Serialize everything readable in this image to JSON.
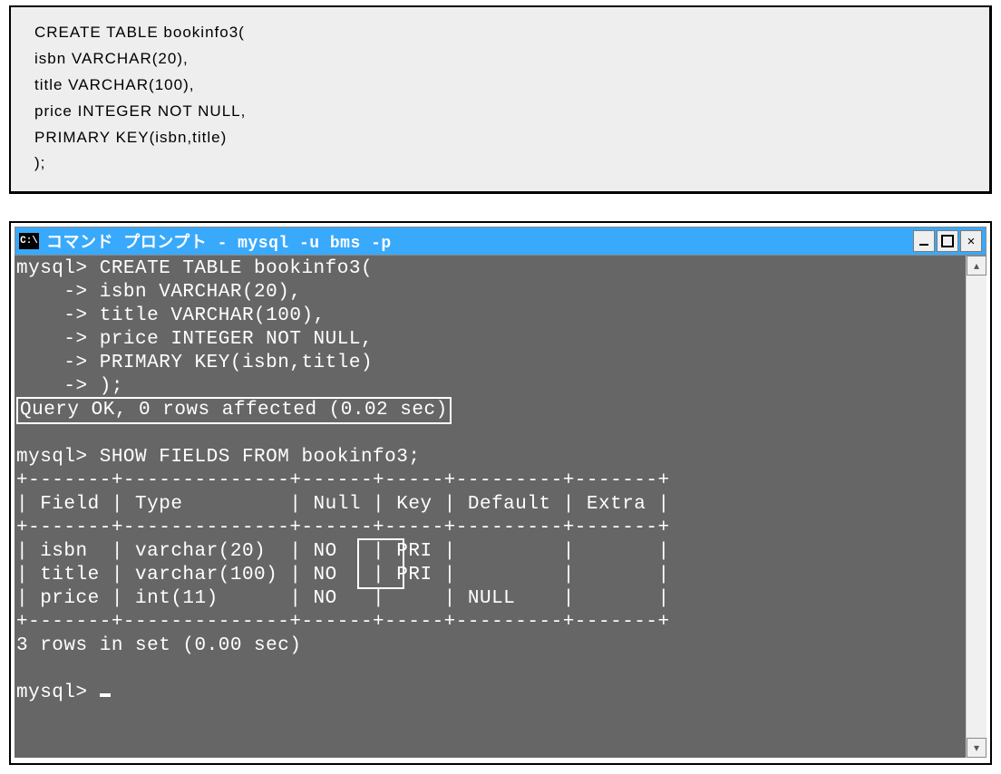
{
  "code_panel": {
    "lines": [
      "CREATE  TABLE  bookinfo3(",
      "isbn  VARCHAR(20),",
      "title  VARCHAR(100),",
      "price  INTEGER  NOT  NULL,",
      "PRIMARY  KEY(isbn,title)",
      ");"
    ]
  },
  "terminal": {
    "icon_text": "C:\\",
    "title": "コマンド プロンプト - mysql -u bms -p",
    "buttons": {
      "minimize": "_",
      "maximize": "□",
      "close": "×"
    },
    "content_lines": [
      "mysql> CREATE TABLE bookinfo3(",
      "    -> isbn VARCHAR(20),",
      "    -> title VARCHAR(100),",
      "    -> price INTEGER NOT NULL,",
      "    -> PRIMARY KEY(isbn,title)",
      "    -> );"
    ],
    "query_ok": "Query OK, 0 rows affected (0.02 sec)",
    "show_fields_cmd": "mysql> SHOW FIELDS FROM bookinfo3;",
    "table_border": "+-------+--------------+------+-----+---------+-------+",
    "table_header": "| Field | Type         | Null | Key | Default | Extra |",
    "table_rows": [
      "| isbn  | varchar(20)  | NO   | PRI |         |       |",
      "| title | varchar(100) | NO   | PRI |         |       |",
      "| price | int(11)      | NO   |     | NULL    |       |"
    ],
    "rows_in_set": "3 rows in set (0.00 sec)",
    "prompt": "mysql> "
  }
}
